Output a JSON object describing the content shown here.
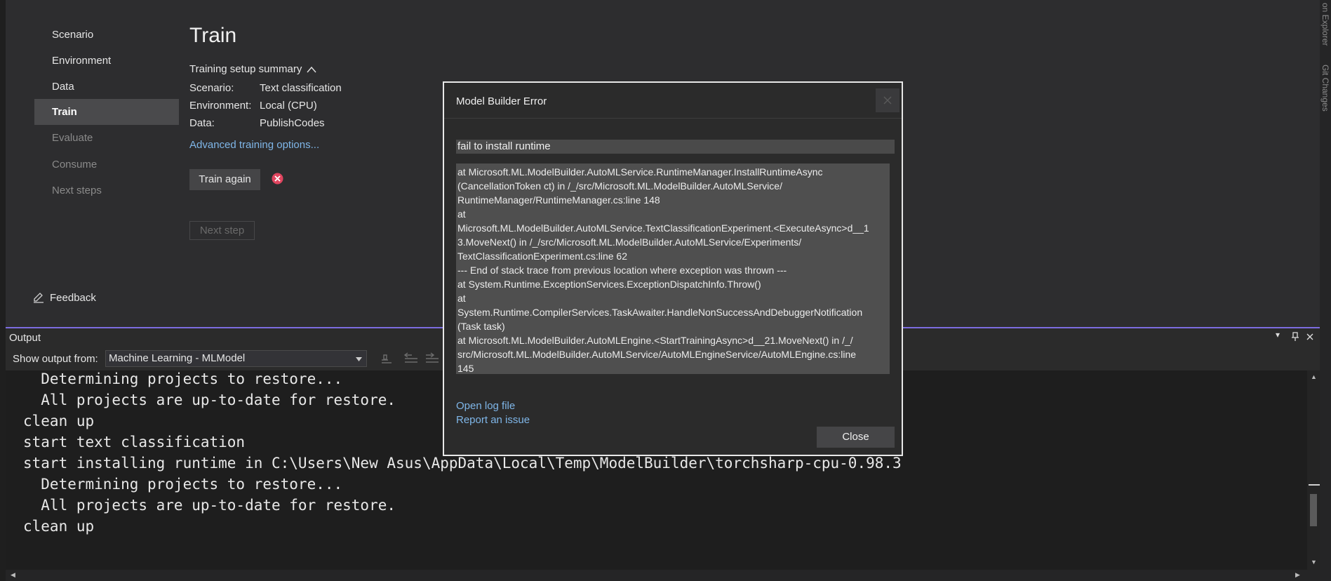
{
  "nav": {
    "items": [
      {
        "label": "Scenario",
        "state": "normal"
      },
      {
        "label": "Environment",
        "state": "normal"
      },
      {
        "label": "Data",
        "state": "normal"
      },
      {
        "label": "Train",
        "state": "active"
      },
      {
        "label": "Evaluate",
        "state": "disabled"
      },
      {
        "label": "Consume",
        "state": "disabled"
      },
      {
        "label": "Next steps",
        "state": "disabled"
      }
    ],
    "feedback": "Feedback"
  },
  "train": {
    "title": "Train",
    "summary_label": "Training setup summary",
    "scenario_key": "Scenario:",
    "scenario_val": "Text classification",
    "environment_key": "Environment:",
    "environment_val": "Local (CPU)",
    "data_key": "Data:",
    "data_val": "PublishCodes",
    "advanced_link": "Advanced training options...",
    "train_again": "Train again",
    "next_step": "Next step"
  },
  "side_tabs": {
    "a": "on Explorer",
    "b": "Git Changes"
  },
  "output": {
    "title": "Output",
    "show_from_label": "Show output from:",
    "source": "Machine Learning - MLModel",
    "lines": [
      "  Determining projects to restore...",
      "  All projects are up-to-date for restore.",
      "clean up",
      "start text classification",
      "start installing runtime in C:\\Users\\New Asus\\AppData\\Local\\Temp\\ModelBuilder\\torchsharp-cpu-0.98.3",
      "  Determining projects to restore...",
      "  All projects are up-to-date for restore.",
      "clean up"
    ]
  },
  "dialog": {
    "title": "Model Builder Error",
    "message": "fail to install runtime",
    "trace": [
      "   at Microsoft.ML.ModelBuilder.AutoMLService.RuntimeManager.InstallRuntimeAsync",
      "(CancellationToken ct) in /_/src/Microsoft.ML.ModelBuilder.AutoMLService/",
      "RuntimeManager/RuntimeManager.cs:line 148",
      "   at",
      "Microsoft.ML.ModelBuilder.AutoMLService.TextClassificationExperiment.<ExecuteAsync>d__1",
      "3.MoveNext() in /_/src/Microsoft.ML.ModelBuilder.AutoMLService/Experiments/",
      "TextClassificationExperiment.cs:line 62",
      "--- End of stack trace from previous location where exception was thrown ---",
      "   at System.Runtime.ExceptionServices.ExceptionDispatchInfo.Throw()",
      "   at",
      "System.Runtime.CompilerServices.TaskAwaiter.HandleNonSuccessAndDebuggerNotification",
      "(Task task)",
      "   at Microsoft.ML.ModelBuilder.AutoMLEngine.<StartTrainingAsync>d__21.MoveNext() in /_/",
      "src/Microsoft.ML.ModelBuilder.AutoMLService/AutoMLEngineService/AutoMLEngine.cs:line",
      "145"
    ],
    "open_log": "Open log file",
    "report_issue": "Report an issue",
    "close": "Close"
  }
}
